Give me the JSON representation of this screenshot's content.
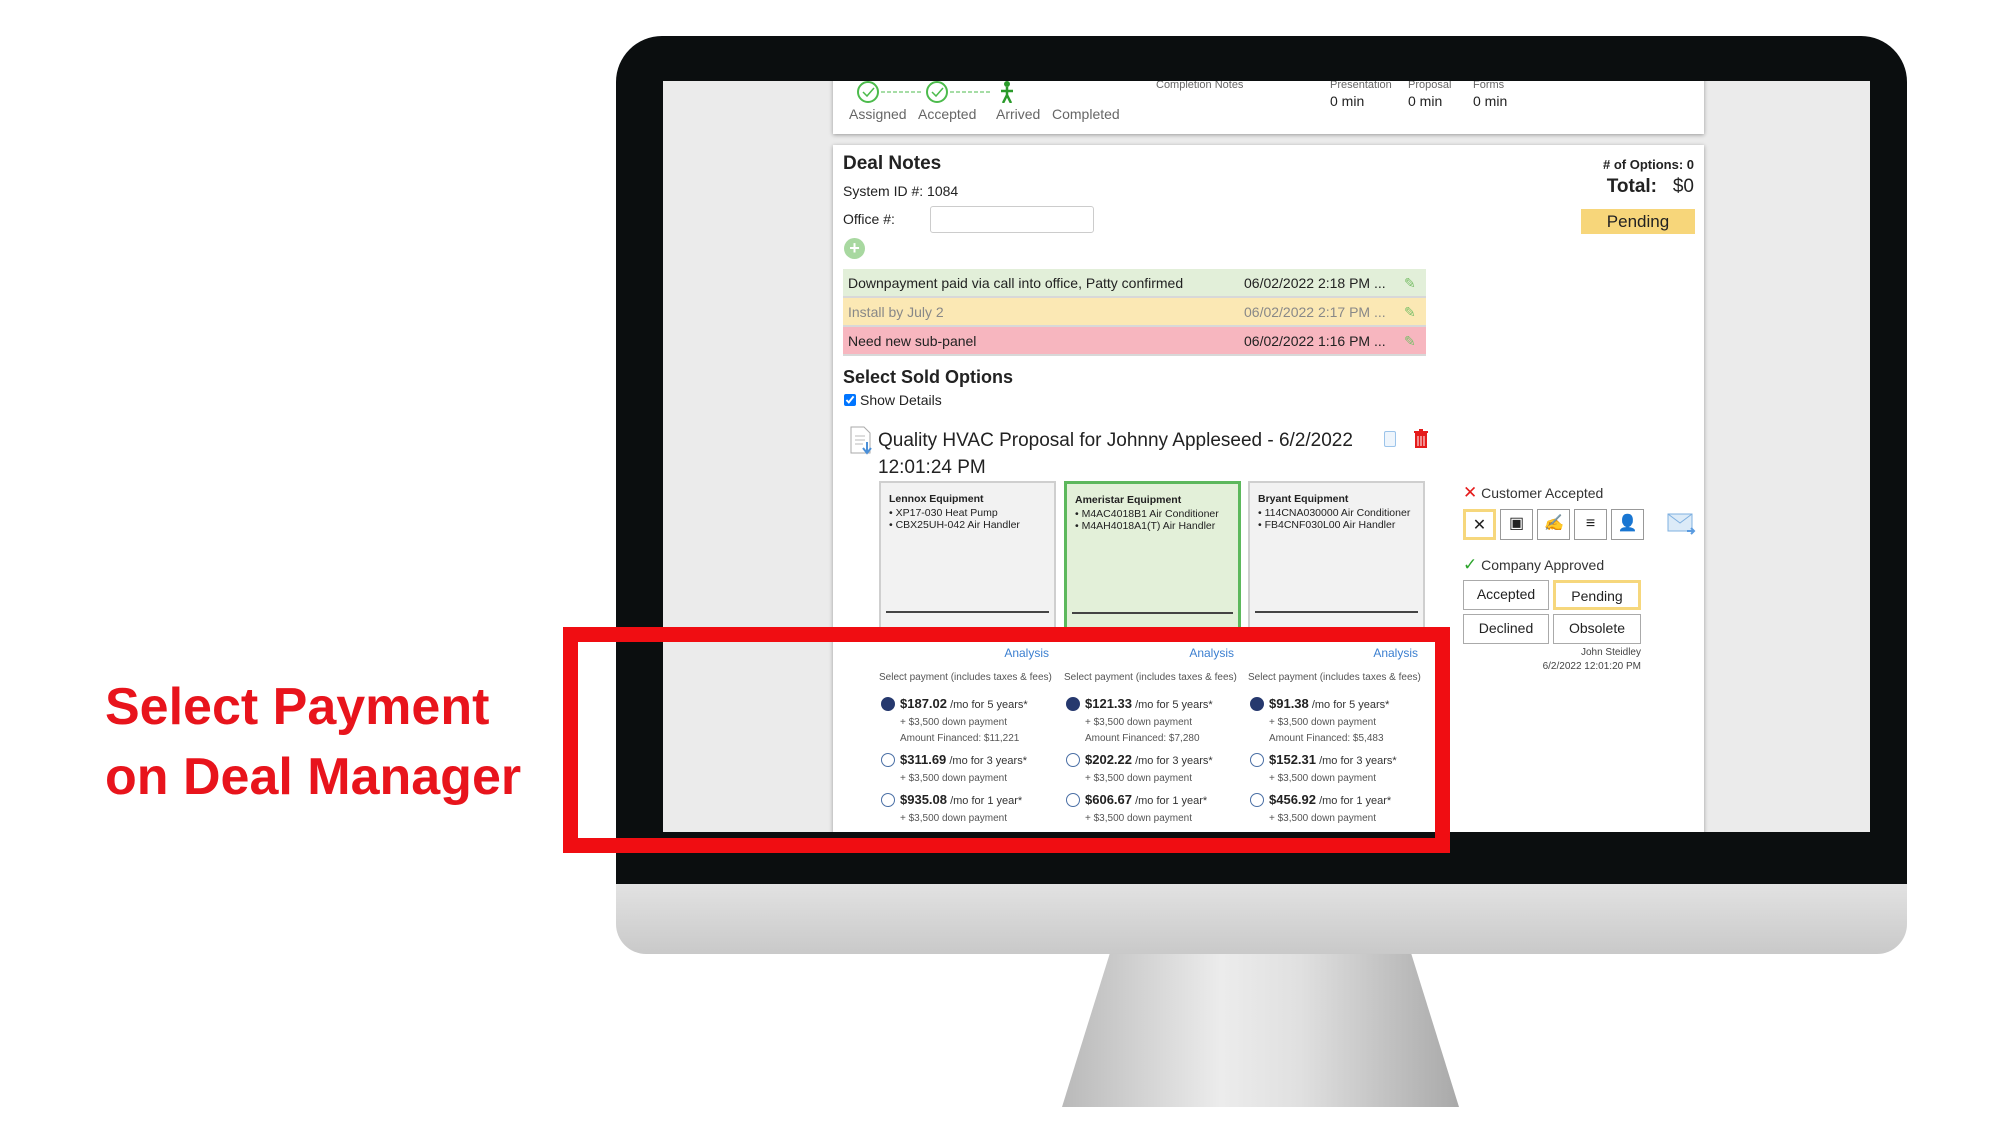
{
  "callout": {
    "line1": "Select Payment",
    "line2": "on Deal Manager"
  },
  "status": {
    "steps": [
      "Assigned",
      "Accepted",
      "Arrived",
      "Completed"
    ],
    "completion_notes": "Completion Notes",
    "timers": [
      {
        "label": "Presentation",
        "value": "0 min"
      },
      {
        "label": "Proposal",
        "value": "0 min"
      },
      {
        "label": "Forms",
        "value": "0 min"
      }
    ]
  },
  "deal": {
    "title": "Deal Notes",
    "system_id_label": "System ID #:",
    "system_id": "1084",
    "office_label": "Office #:",
    "office_value": "",
    "options_count": "# of Options: 0",
    "total_label": "Total:",
    "total_value": "$0",
    "status_button": "Pending",
    "notes": [
      {
        "text": "Downpayment paid via call into office, Patty confirmed",
        "date": "06/02/2022 2:18 PM ...",
        "color": "#e2efd9"
      },
      {
        "text": "Install by July 2",
        "date": "06/02/2022 2:17 PM ...",
        "color": "#fbe8b4"
      },
      {
        "text": "Need new sub-panel",
        "date": "06/02/2022 1:16 PM ...",
        "color": "#f7b6bf"
      }
    ]
  },
  "sold": {
    "title": "Select Sold Options",
    "show_details": "Show Details",
    "show_details_checked": true,
    "proposal_title": "Quality HVAC Proposal for Johnny Appleseed - 6/2/2022 12:01:24 PM",
    "analysis": "Analysis",
    "payment_header": "Select payment (includes taxes & fees)",
    "options": [
      {
        "name": "Lennox Equipment",
        "items": [
          "XP17-030 Heat Pump",
          "CBX25UH-042 Air Handler"
        ],
        "selected": false,
        "payments": [
          {
            "price": "$187.02",
            "term": "/mo for 5 years*",
            "down": "+ $3,500 down payment",
            "financed": "Amount Financed: $11,221",
            "checked": true
          },
          {
            "price": "$311.69",
            "term": "/mo for 3 years*",
            "down": "+ $3,500 down payment",
            "checked": false
          },
          {
            "price": "$935.08",
            "term": "/mo for 1 year*",
            "down": "+ $3,500 down payment",
            "checked": false
          }
        ]
      },
      {
        "name": "Ameristar Equipment",
        "items": [
          "M4AC4018B1 Air Conditioner",
          "M4AH4018A1(T) Air Handler"
        ],
        "selected": true,
        "payments": [
          {
            "price": "$121.33",
            "term": "/mo for 5 years*",
            "down": "+ $3,500 down payment",
            "financed": "Amount Financed: $7,280",
            "checked": true
          },
          {
            "price": "$202.22",
            "term": "/mo for 3 years*",
            "down": "+ $3,500 down payment",
            "checked": false
          },
          {
            "price": "$606.67",
            "term": "/mo for 1 year*",
            "down": "+ $3,500 down payment",
            "checked": false
          }
        ]
      },
      {
        "name": "Bryant Equipment",
        "items": [
          "114CNA030000 Air Conditioner",
          "FB4CNF030L00 Air Handler"
        ],
        "selected": false,
        "payments": [
          {
            "price": "$91.38",
            "term": "/mo for 5 years*",
            "down": "+ $3,500 down payment",
            "financed": "Amount Financed: $5,483",
            "checked": true
          },
          {
            "price": "$152.31",
            "term": "/mo for 3 years*",
            "down": "+ $3,500 down payment",
            "checked": false
          },
          {
            "price": "$456.92",
            "term": "/mo for 1 year*",
            "down": "+ $3,500 down payment",
            "checked": false
          }
        ]
      }
    ]
  },
  "approval": {
    "customer_label": "Customer Accepted",
    "company_label": "Company Approved",
    "buttons": [
      "Accepted",
      "Pending",
      "Declined",
      "Obsolete"
    ],
    "user": "John Steidley",
    "timestamp": "6/2/2022 12:01:20 PM"
  },
  "colors": {
    "callout": "#e8141c",
    "pending": "#f7d67a",
    "selected_card": "#e3f0d9",
    "link": "#3b7fd0",
    "radio": "#26396e"
  }
}
